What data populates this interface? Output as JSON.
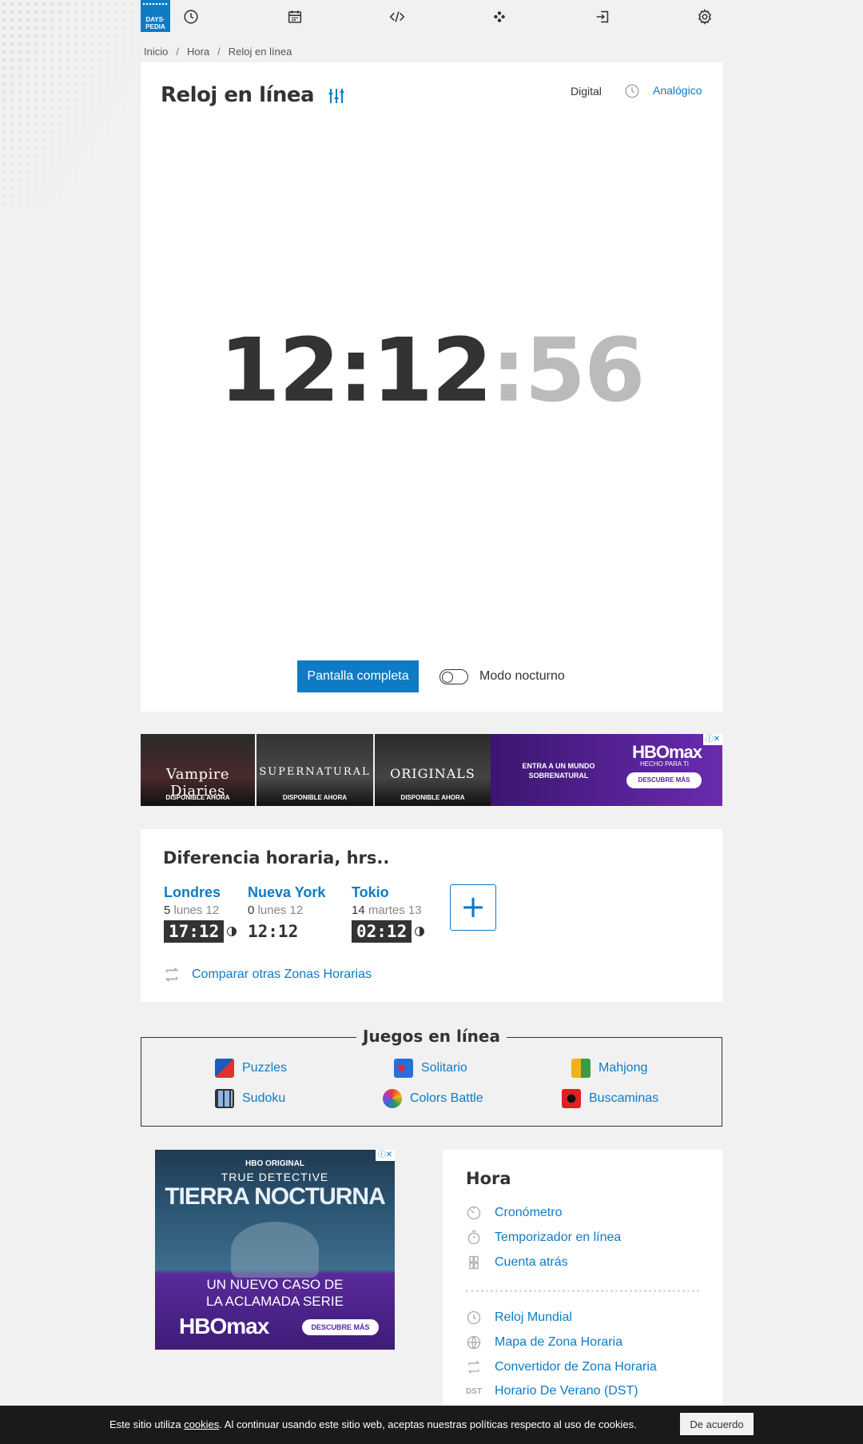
{
  "header": {
    "logo_line1": "DAYS·",
    "logo_line2": "PEDIA",
    "nav_icons": [
      "clock-icon",
      "calendar-icon",
      "code-icon",
      "games-icon",
      "login-icon",
      "gear-icon"
    ]
  },
  "breadcrumb": [
    "Inicio",
    "Hora",
    "Reloj en línea"
  ],
  "clock_panel": {
    "title": "Reloj en línea",
    "mode_digital": "Digital",
    "mode_analog": "Analógico",
    "time_hm": "12:12",
    "time_sec": ":56",
    "fullscreen_label": "Pantalla completa",
    "night_mode_label": "Modo nocturno",
    "night_mode_on": false
  },
  "ad_banner": {
    "posters": [
      {
        "title": "Vampire Diaries",
        "tagline": "DISPONIBLE AHORA"
      },
      {
        "title": "SUPERNATURAL",
        "tagline": "DISPONIBLE AHORA"
      },
      {
        "title": "ORIGINALS",
        "tagline": "DISPONIBLE AHORA"
      }
    ],
    "hbo_line": "ENTRA A UN MUNDO SOBRENATURAL",
    "hbo_logo": "HBOmax",
    "hbo_sub": "HECHO PARA TI",
    "hbo_cta": "DESCUBRE MÁS"
  },
  "time_diff": {
    "title": "Diferencia horaria, hrs..",
    "cities": [
      {
        "name": "Londres",
        "offset": "5",
        "day": "lunes 12",
        "time": "17:12",
        "dark": true
      },
      {
        "name": "Nueva York",
        "offset": "0",
        "day": "lunes 12",
        "time": "12:12",
        "dark": false
      },
      {
        "name": "Tokio",
        "offset": "14",
        "day": "martes 13",
        "time": "02:12",
        "dark": true
      }
    ],
    "add_label": "+",
    "compare_link": "Comparar otras Zonas Horarias"
  },
  "games": {
    "title": "Juegos en línea",
    "items": [
      "Puzzles",
      "Solitario",
      "Mahjong",
      "Sudoku",
      "Colors Battle",
      "Buscaminas"
    ]
  },
  "ad_square": {
    "orig": "HBO ORIGINAL",
    "show1": "TRUE DETECTIVE",
    "show2": "TIERRA NOCTURNA",
    "tagline1": "UN NUEVO CASO DE",
    "tagline2": "LA ACLAMADA SERIE",
    "logo": "HBOmax",
    "cta": "DESCUBRE MÁS"
  },
  "sidebar": {
    "title": "Hora",
    "group1": [
      "Cronómetro",
      "Temporizador en línea",
      "Cuenta atrás"
    ],
    "group2": [
      "Reloj Mundial",
      "Mapa de Zona Horaria",
      "Convertidor de Zona Horaria",
      "Horario De Verano (DST)"
    ],
    "dst_badge": "DST"
  },
  "cookie_bar": {
    "text_before": "Este sitio utiliza ",
    "link": "cookies",
    "text_after": ". Al continuar usando este sitio web, aceptas nuestras políticas respecto al uso de cookies.",
    "accept": "De acuerdo"
  },
  "colors": {
    "accent": "#0e7bc4",
    "text": "#333333",
    "muted": "#bbbbbb"
  }
}
